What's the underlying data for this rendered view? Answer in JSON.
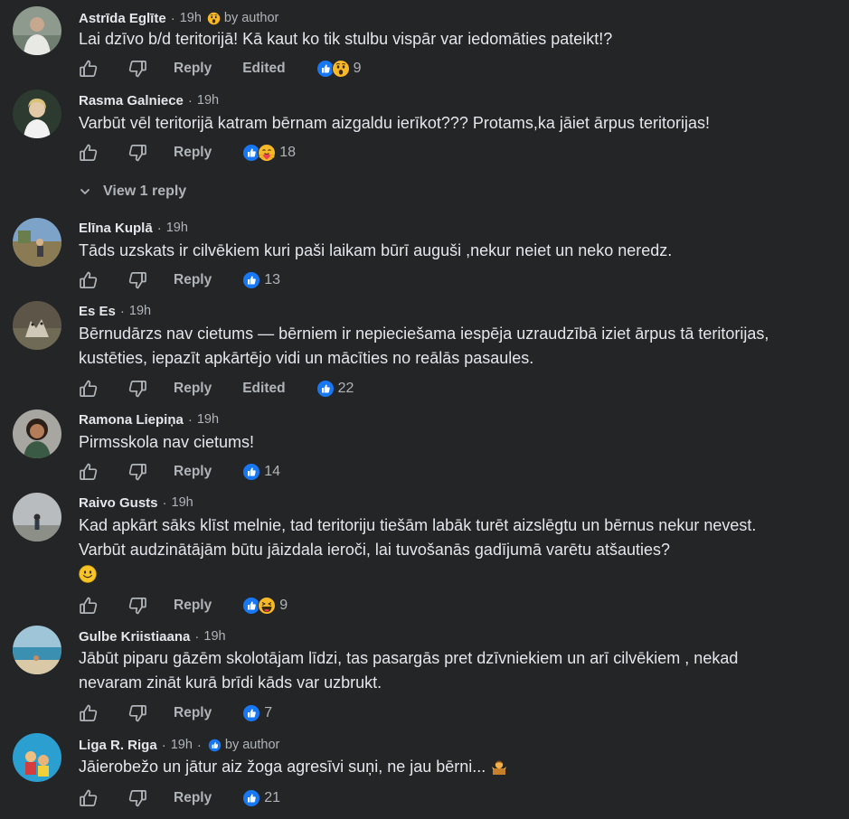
{
  "labels": {
    "reply": "Reply",
    "edited": "Edited",
    "by_author": "by author",
    "view_replies": "View 1 reply",
    "sep": "·"
  },
  "comments": [
    {
      "author": "Astrīda Eglīte",
      "time": "19h",
      "text": "Lai dzīvo b/d teritorijā! Kā kaut ko tik stulbu vispār var iedomāties pateikt!?",
      "count": "9",
      "edited": true
    },
    {
      "author": "Rasma Galniece",
      "time": "19h",
      "text": "Varbūt vēl teritorijā katram bērnam aizgaldu ierīkot??? Protams,ka jāiet ārpus teritorijas!",
      "count": "18"
    },
    {
      "author": "Elīna Kuplā",
      "time": "19h",
      "text": "Tāds uzskats ir cilvēkiem kuri paši laikam būrī auguši ,nekur neiet un neko neredz.",
      "count": "13"
    },
    {
      "author": "Es Es",
      "time": "19h",
      "text": "Bērnudārzs nav cietums — bērniem ir nepieciešama iespēja uzraudzībā iziet ārpus tā teritorijas, kustēties, iepazīt apkārtējo vidi un mācīties no reālās pasaules.",
      "count": "22",
      "edited": true
    },
    {
      "author": "Ramona Liepiņa",
      "time": "19h",
      "text": "Pirmsskola nav cietums!",
      "count": "14"
    },
    {
      "author": "Raivo Gusts",
      "time": "19h",
      "text": "Kad apkārt sāks klīst melnie, tad teritoriju tiešām labāk turēt aizslēgtu un bērnus nekur nevest. Varbūt audzinātājām būtu jāizdala ieroči, lai tuvošanās gadījumā varētu atšauties?",
      "count": "9"
    },
    {
      "author": "Gulbe Kriistiaana",
      "time": "19h",
      "text": "Jābūt piparu gāzēm skolotājam līdzi, tas pasargās pret dzīvniekiem un arī cilvēkiem , nekad nevaram zināt kurā brīdi kāds var uzbrukt.",
      "count": "7"
    },
    {
      "author": "Liga R. Riga",
      "time": "19h",
      "text": "Jāierobežo un jātur aiz žoga agresīvi suņi, ne jau bērni...",
      "count": "21"
    }
  ],
  "colors": {
    "background": "#242526",
    "primary_text": "#e4e6eb",
    "secondary_text": "#b0b3b8",
    "like_blue": "#1877f2",
    "emoji_yellow": "#f7b928"
  },
  "icons": {
    "upvote": "thumb-up-outline-icon",
    "downvote": "thumb-down-outline-icon",
    "like": "like-reaction-icon",
    "wow": "wow-reaction-icon",
    "care": "care-reaction-icon",
    "haha": "haha-reaction-icon",
    "smile": "smile-emoji-icon",
    "shrug": "person-shrugging-emoji-icon",
    "chevron": "chevron-down-icon"
  }
}
